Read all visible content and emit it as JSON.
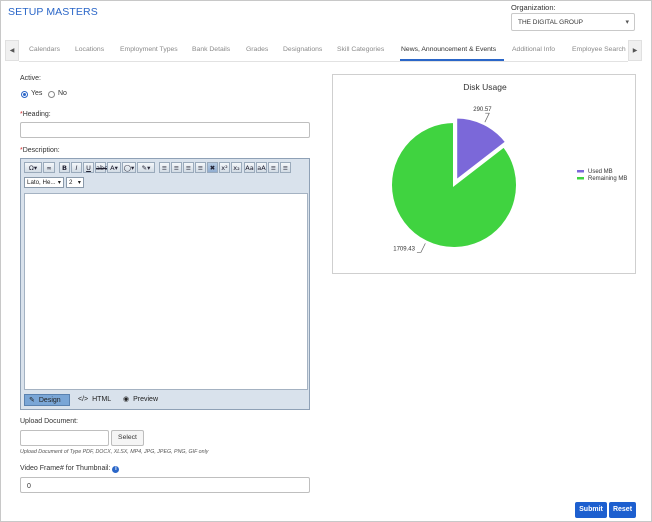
{
  "page": {
    "title": "SETUP MASTERS"
  },
  "organization": {
    "label": "Organization:",
    "value": "THE DIGITAL GROUP"
  },
  "tabs": [
    {
      "label": "Calendars"
    },
    {
      "label": "Locations"
    },
    {
      "label": "Employment Types"
    },
    {
      "label": "Bank Details"
    },
    {
      "label": "Grades"
    },
    {
      "label": "Designations"
    },
    {
      "label": "Skill Categories"
    },
    {
      "label": "News, Announcement & Events",
      "active": true
    },
    {
      "label": "Additional Info"
    },
    {
      "label": "Employee Search"
    }
  ],
  "form": {
    "active_label": "Active:",
    "yes_label": "Yes",
    "no_label": "No",
    "active_value": "Yes",
    "heading_star": "*",
    "heading_label": "Heading:",
    "heading_value": "",
    "description_star": "*",
    "description_label": "Description:",
    "editor": {
      "font_value": "Lato, He...",
      "size_value": "2",
      "tools": [
        "special-char",
        "link",
        "bold",
        "italic",
        "underline",
        "strikethrough",
        "font-color",
        "highlight",
        "paint-format",
        "align-left",
        "align-center",
        "align-right",
        "justify",
        "clear-format",
        "superscript",
        "subscript",
        "uppercase",
        "lowercase",
        "ordered-list",
        "unordered-list"
      ],
      "modes": [
        {
          "label": "Design",
          "active": true
        },
        {
          "label": "HTML"
        },
        {
          "label": "Preview"
        }
      ]
    },
    "upload_label": "Upload Document:",
    "upload_value": "",
    "select_button": "Select",
    "upload_hint": "Upload Document of Type PDF, DOCX, XLSX, MP4, JPG, JPEG, PNG, GIF only",
    "video_frame_label": "Video Frame# for Thumbnail:",
    "video_frame_value": "0",
    "submit_button": "Submit",
    "reset_button": "Reset"
  },
  "chart_data": {
    "type": "pie",
    "title": "Disk Usage",
    "labels": [
      "Used MB",
      "Remaining MB"
    ],
    "values": [
      290.57,
      1709.43
    ],
    "value_labels": [
      "290.57",
      "1709.43"
    ],
    "colors": [
      "#7b68d9",
      "#40d340"
    ],
    "legend_position": "right",
    "exploded": "Used MB"
  }
}
